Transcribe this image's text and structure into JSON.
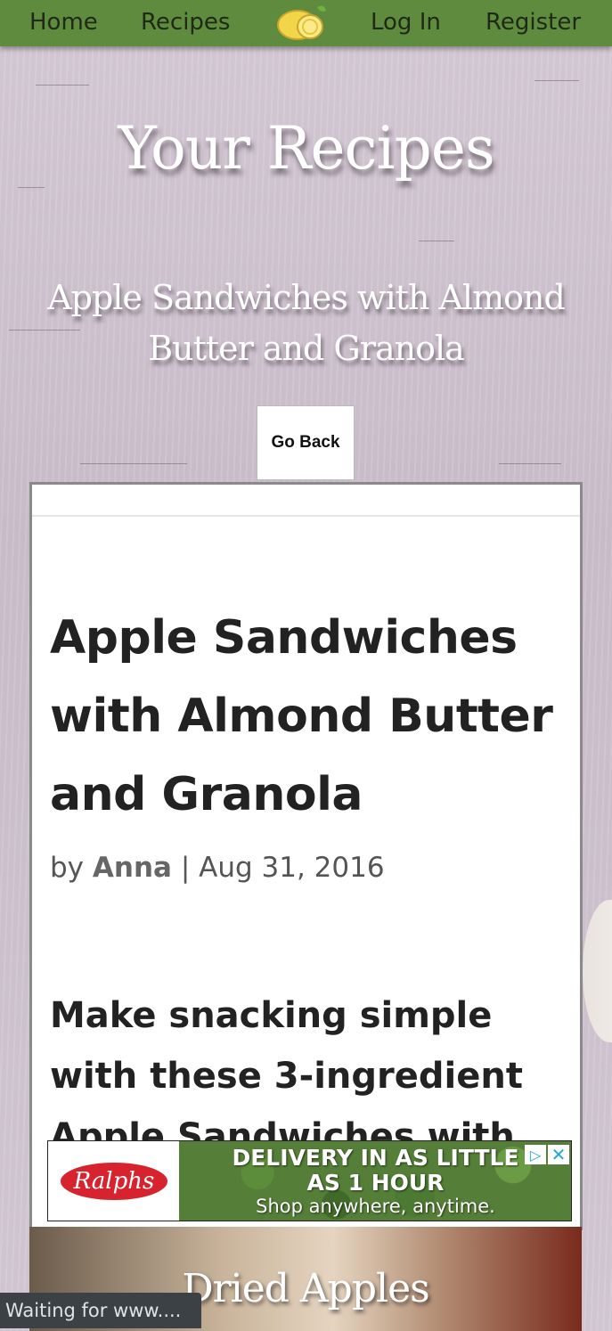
{
  "nav": {
    "home": "Home",
    "recipes": "Recipes",
    "login": "Log In",
    "register": "Register",
    "logo_icon": "lemon-logo-icon",
    "bar_color": "#5f8b3f"
  },
  "page": {
    "title": "Your Recipes",
    "recipe_name": "Apple Sandwiches with Almond Butter and Granola",
    "go_back": "Go Back"
  },
  "article": {
    "title": "Apple Sandwiches with Almond Butter and Granola",
    "by": "by",
    "author": "Anna",
    "separator": "|",
    "date": "Aug 31, 2016",
    "intro": "Make snacking simple with these 3-ingredient Apple Sandwiches with"
  },
  "ad": {
    "brand": "Ralphs",
    "line1": "DELIVERY IN AS LITTLE",
    "line2": "AS 1 HOUR",
    "line3": "Shop anywhere, anytime.",
    "choices_icon": "adchoices-icon",
    "close_icon": "close-icon"
  },
  "next_recipe": {
    "title": "Dried Apples"
  },
  "status_bar": {
    "text": "Waiting for www...."
  }
}
